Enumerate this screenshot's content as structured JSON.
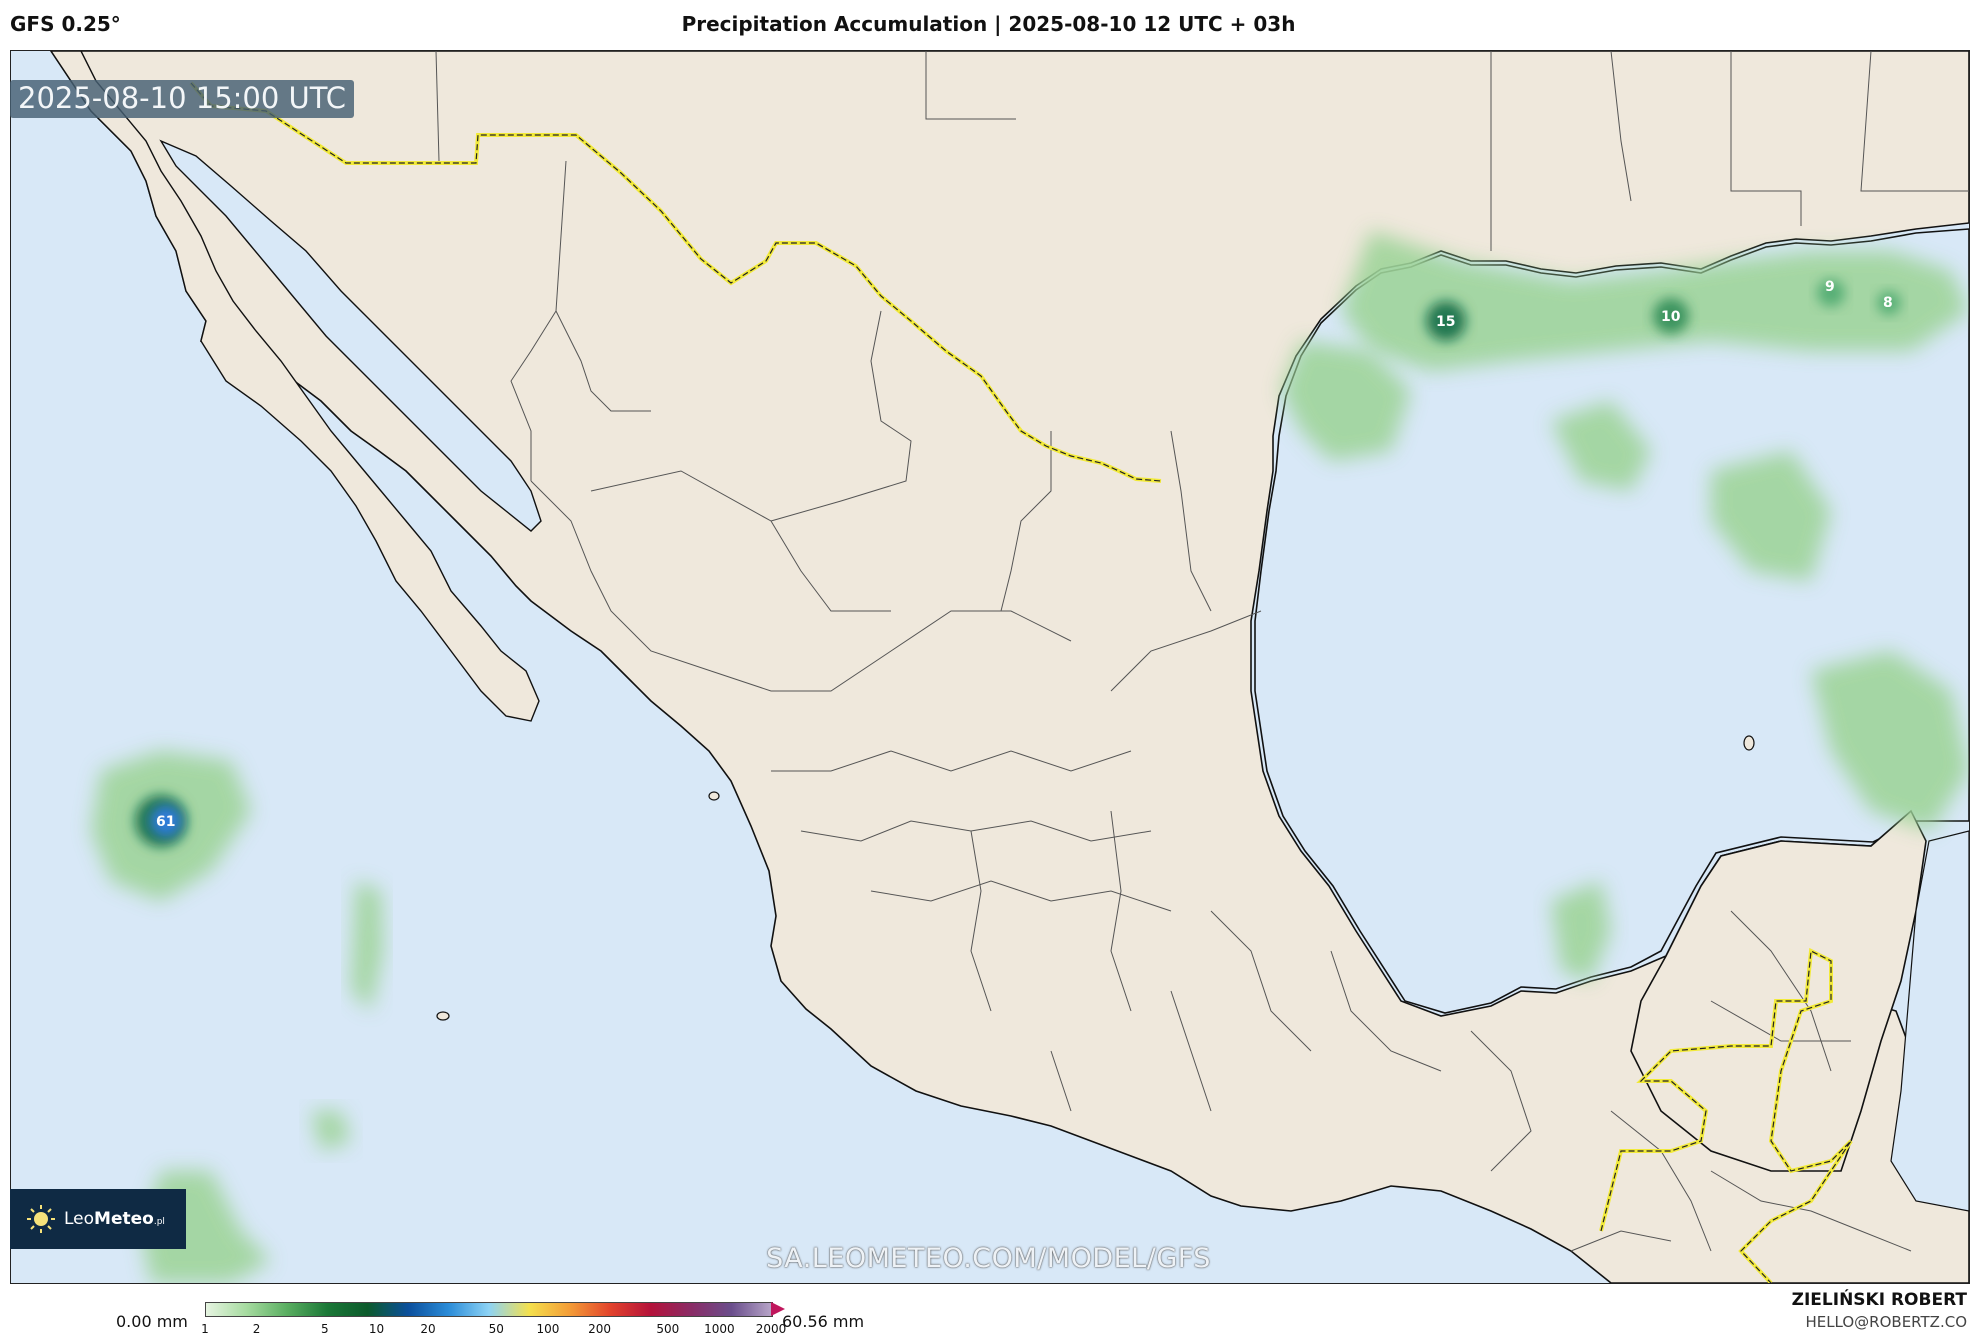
{
  "header": {
    "model": "GFS 0.25°",
    "title": "Precipitation Accumulation | 2025-08-10 12 UTC + 03h"
  },
  "map": {
    "timestamp": "2025-08-10 15:00 UTC",
    "watermark": "SA.LEOMETEO.COM/MODEL/GFS",
    "rain_labels": [
      "15",
      "10",
      "9",
      "8",
      "61"
    ],
    "colors": {
      "ocean": "#d8e8f7",
      "land": "#efe8dc",
      "border_highlight": "#f2ea3a",
      "rain_light": "#9fd49a",
      "rain_mid": "#4aa866",
      "rain_dark": "#0f6b3c",
      "rain_blue": "#1d6fd6"
    }
  },
  "logo": {
    "name_a": "Leo",
    "name_b": "Meteo",
    "suffix": ".pl"
  },
  "colorbar": {
    "min_label": "0.00 mm",
    "max_label": "60.56 mm",
    "ticks": [
      "1",
      "2",
      "5",
      "10",
      "20",
      "50",
      "100",
      "200",
      "500",
      "1000",
      "2000"
    ],
    "colors": [
      "#e6f4e1",
      "#a6dba0",
      "#5aae61",
      "#1b7837",
      "#0c5a2c",
      "#0b4f9c",
      "#2b8cd8",
      "#8dd3f5",
      "#f4e04d",
      "#f39c37",
      "#e2432c",
      "#b4123a",
      "#8a2c66",
      "#6a4e8c",
      "#b8a6c9"
    ]
  },
  "credit": {
    "name": "ZIELIŃSKI ROBERT",
    "email": "HELLO@ROBERTZ.CO"
  }
}
